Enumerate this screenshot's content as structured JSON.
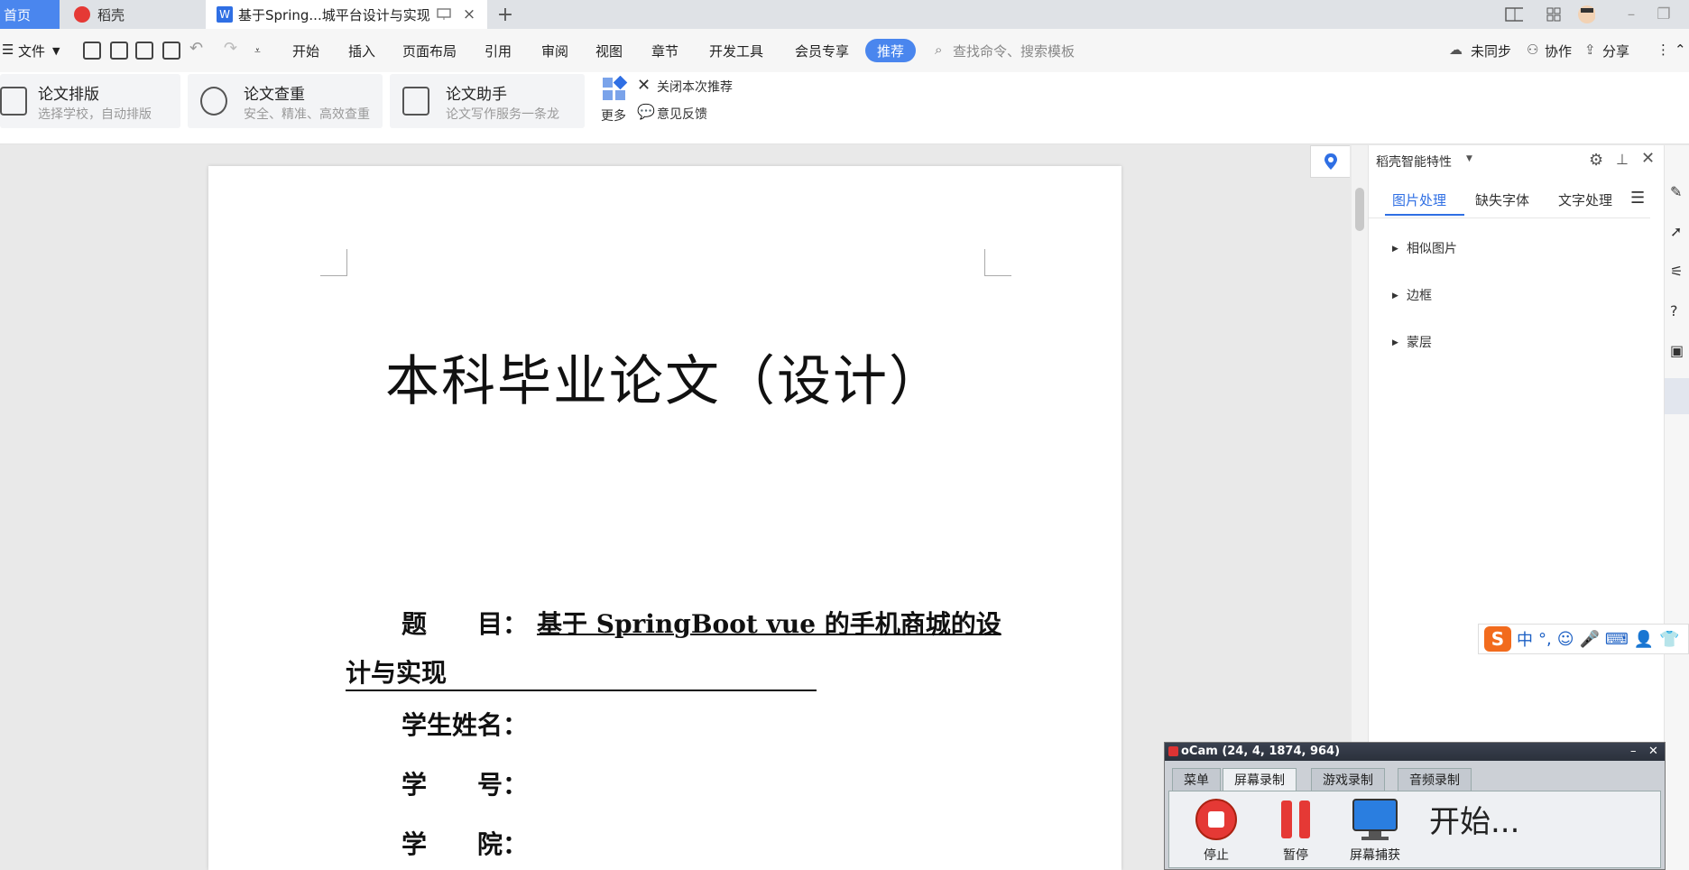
{
  "tabs": {
    "home": "首页",
    "daoke": "稻壳",
    "doc": "基于Spring...城平台设计与实现",
    "add": "+"
  },
  "menu": {
    "file": "文件",
    "items": [
      "开始",
      "插入",
      "页面布局",
      "引用",
      "审阅",
      "视图",
      "章节",
      "开发工具",
      "会员专享"
    ],
    "recommend": "推荐",
    "search_placeholder": "查找命令、搜索模板",
    "unsynced": "未同步",
    "collab": "协作",
    "share": "分享"
  },
  "ribbon": {
    "typeset_title": "论文排版",
    "typeset_sub": "选择学校，自动排版",
    "check_title": "论文查重",
    "check_sub": "安全、精准、高效查重",
    "assistant_title": "论文助手",
    "assistant_sub": "论文写作服务一条龙",
    "more": "更多",
    "close_recommend": "关闭本次推荐",
    "feedback": "意见反馈"
  },
  "document": {
    "title": "本科毕业论文（设计）",
    "subject_label": "题　　目：",
    "subject_value_line1": "基于 SpringBoot vue 的手机商城的设",
    "subject_value_line2": "计与实现",
    "student_name_label": "学生姓名：",
    "student_no_label": "学　　号：",
    "college_label": "学　　院："
  },
  "side_panel": {
    "title": "稻壳智能特性",
    "tabs": [
      "图片处理",
      "缺失字体",
      "文字处理"
    ],
    "active_tab_index": 0,
    "tree": [
      "相似图片",
      "边框",
      "蒙层"
    ]
  },
  "ime": {
    "logo": "S",
    "mode": "中"
  },
  "ocam": {
    "title": "oCam (24, 4, 1874, 964)",
    "tabs": [
      "菜单",
      "屏幕录制",
      "游戏录制",
      "音频录制"
    ],
    "active_tab_index": 1,
    "stop": "停止",
    "pause": "暂停",
    "capture": "屏幕捕获",
    "status": "开始..."
  },
  "colors": {
    "accent": "#4a86ee",
    "doc_blue": "#2f6fe4",
    "record_red": "#e53935"
  }
}
